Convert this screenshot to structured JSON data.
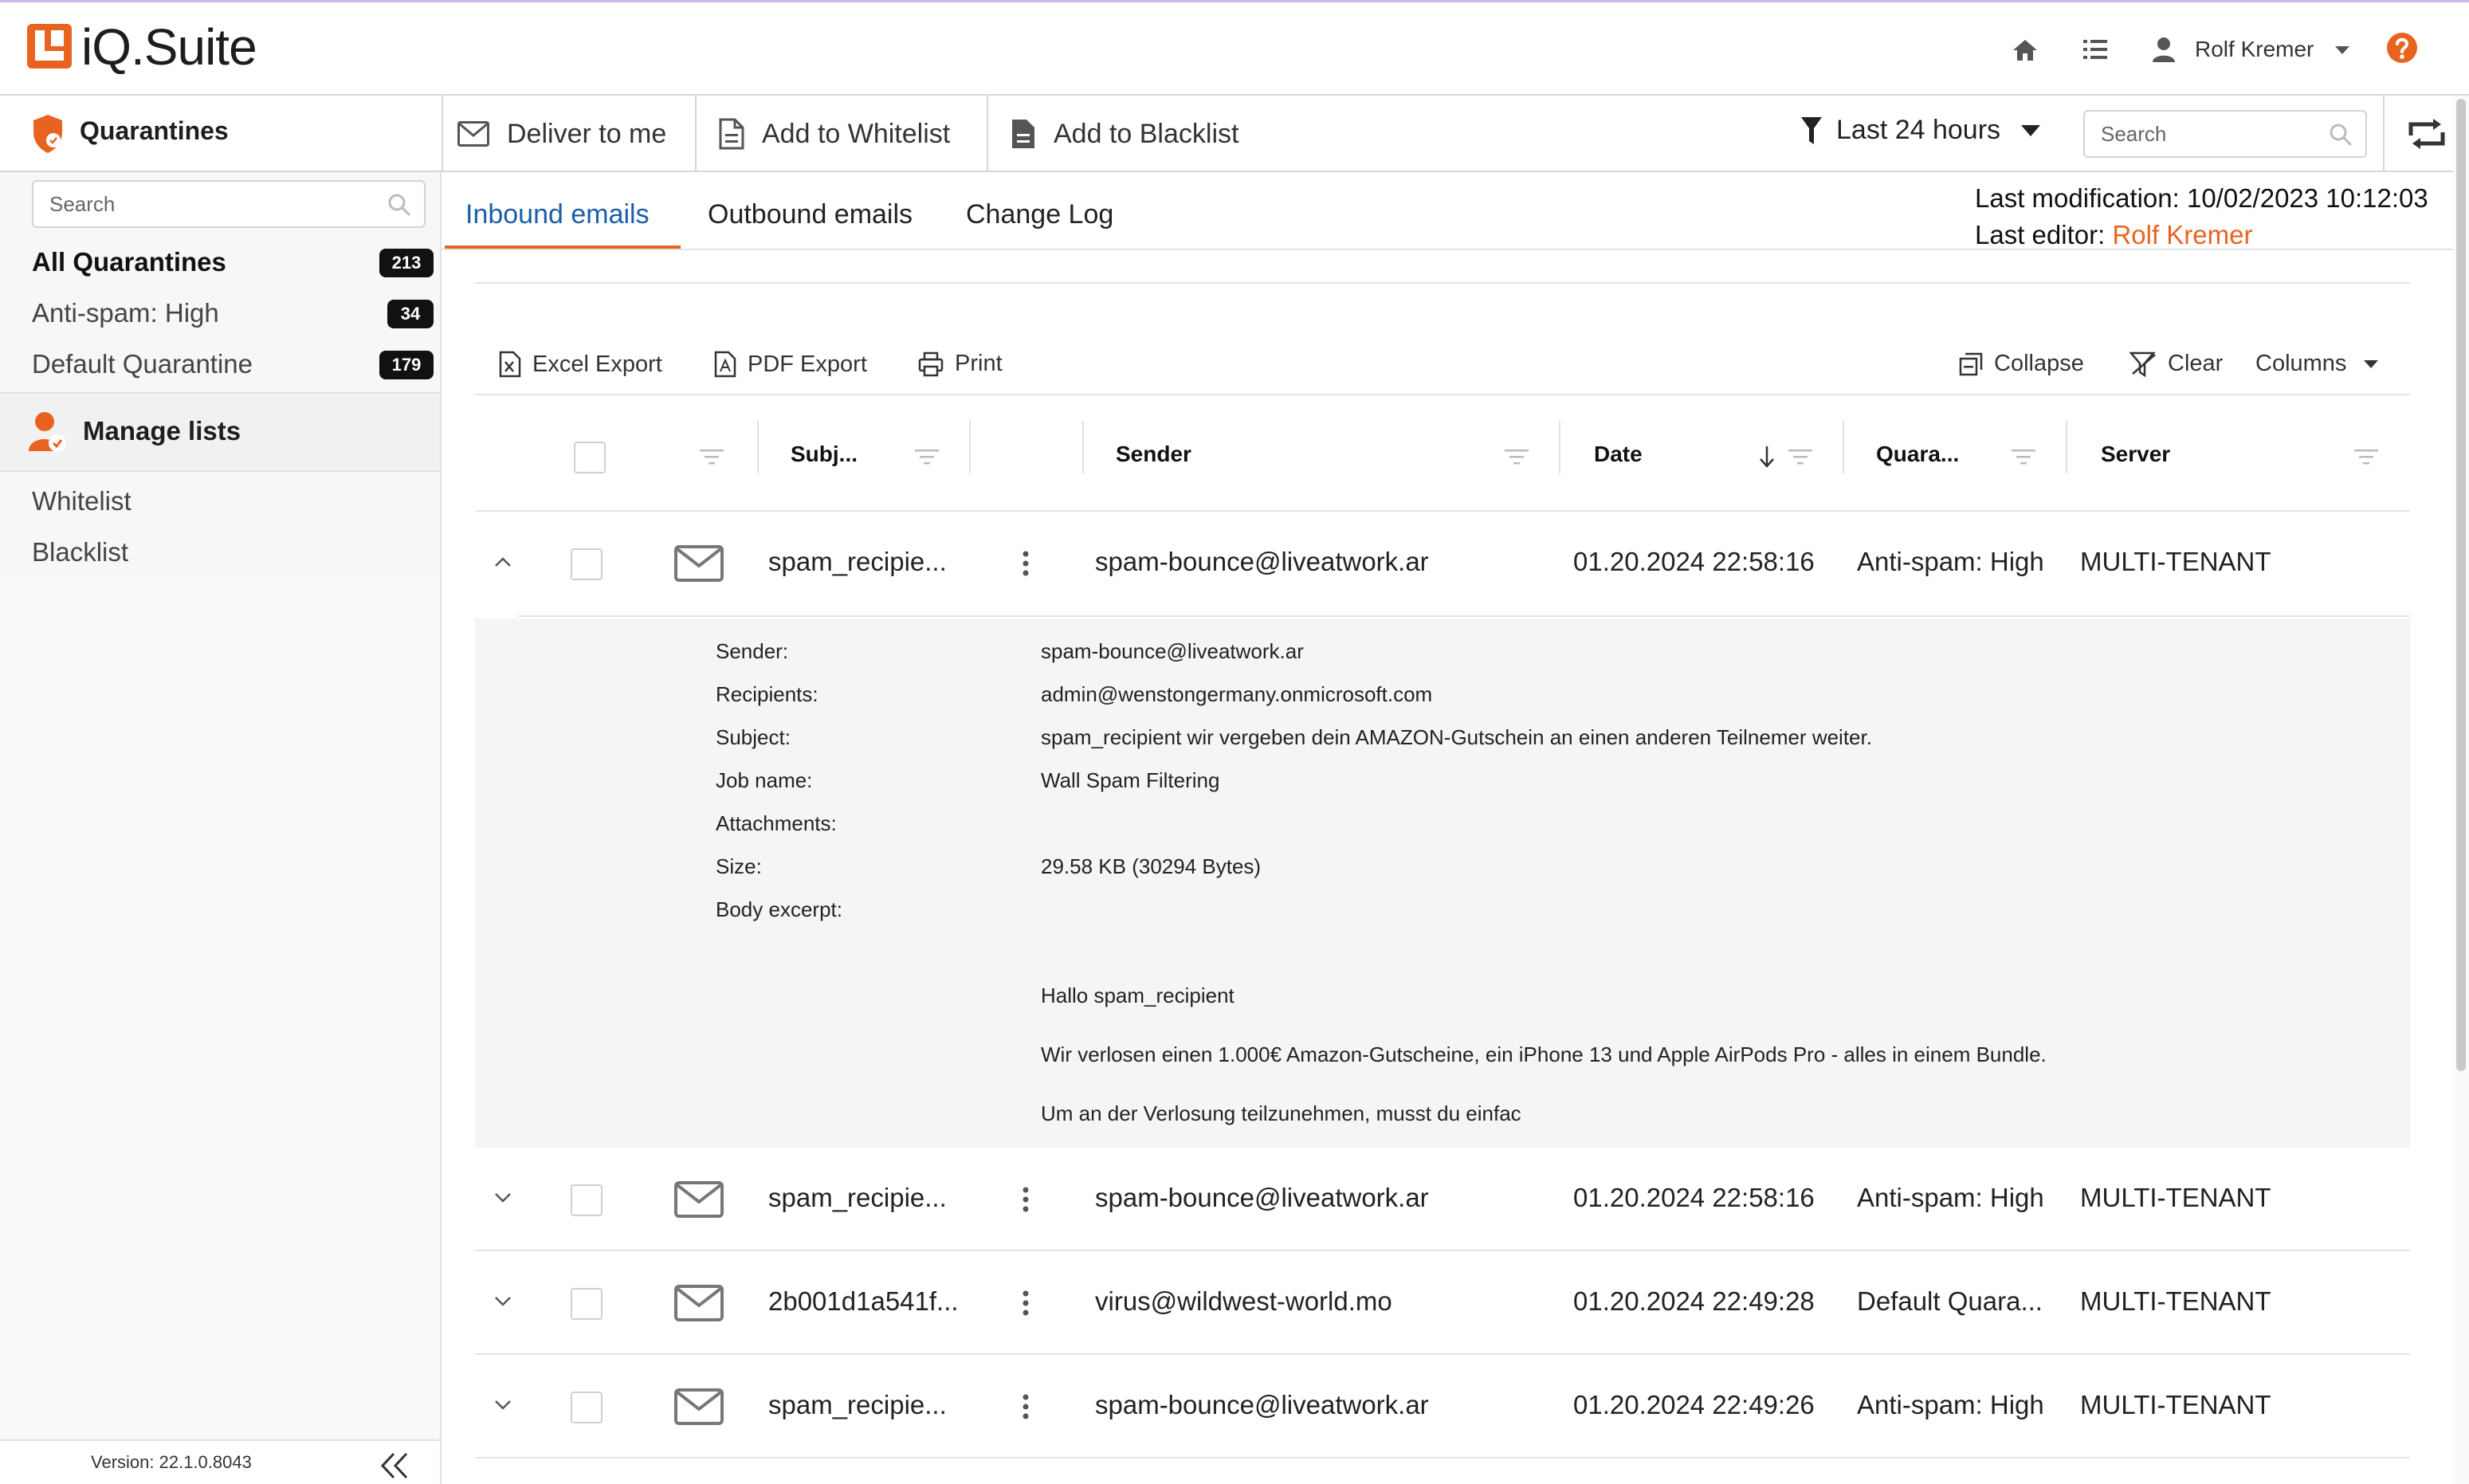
{
  "app": {
    "title": "iQ.Suite"
  },
  "user": {
    "name": "Rolf Kremer"
  },
  "icons": {
    "logo": "iq-suite-logo",
    "home": "home-icon",
    "list": "list-icon",
    "user": "user-icon",
    "help": "help-icon",
    "search": "search-icon",
    "refresh": "refresh-icon",
    "mail": "envelope-icon"
  },
  "colors": {
    "accent": "#e8631f",
    "link": "#1b5ea7",
    "badge": "#111111"
  },
  "toolbar": {
    "section_title": "Quarantines",
    "deliver_label": "Deliver to me",
    "whitelist_label": "Add to Whitelist",
    "blacklist_label": "Add to Blacklist",
    "filter_label": "Last 24 hours",
    "search_placeholder": "Search"
  },
  "sidebar": {
    "search_placeholder": "Search",
    "quarantines": [
      {
        "label": "All Quarantines",
        "count": "213"
      },
      {
        "label": "Anti-spam: High",
        "count": "34"
      },
      {
        "label": "Default Quarantine",
        "count": "179"
      }
    ],
    "manage_lists_title": "Manage lists",
    "lists": [
      {
        "label": "Whitelist"
      },
      {
        "label": "Blacklist"
      }
    ],
    "version": "Version: 22.1.0.8043"
  },
  "tabs": [
    {
      "label": "Inbound emails"
    },
    {
      "label": "Outbound emails"
    },
    {
      "label": "Change Log"
    }
  ],
  "meta": {
    "last_modification": "Last modification: 10/02/2023 10:12:03",
    "last_editor_label": "Last editor:",
    "last_editor_name": "Rolf Kremer"
  },
  "actions": {
    "excel": "Excel Export",
    "pdf": "PDF Export",
    "print": "Print",
    "collapse": "Collapse",
    "clear": "Clear",
    "columns": "Columns"
  },
  "table": {
    "columns": [
      "Subj...",
      "Sender",
      "Date",
      "Quara...",
      "Server"
    ],
    "rows": [
      {
        "subject": "spam_recipie...",
        "sender": "spam-bounce@liveatwork.ar",
        "date": "01.20.2024 22:58:16",
        "quarantine": "Anti-spam: High",
        "server": "MULTI-TENANT",
        "expanded": true
      },
      {
        "subject": "spam_recipie...",
        "sender": "spam-bounce@liveatwork.ar",
        "date": "01.20.2024 22:58:16",
        "quarantine": "Anti-spam: High",
        "server": "MULTI-TENANT",
        "expanded": false
      },
      {
        "subject": "2b001d1a541f...",
        "sender": "virus@wildwest-world.mo",
        "date": "01.20.2024 22:49:28",
        "quarantine": "Default Quara...",
        "server": "MULTI-TENANT",
        "expanded": false
      },
      {
        "subject": "spam_recipie...",
        "sender": "spam-bounce@liveatwork.ar",
        "date": "01.20.2024 22:49:26",
        "quarantine": "Anti-spam: High",
        "server": "MULTI-TENANT",
        "expanded": false
      }
    ]
  },
  "detail": {
    "labels": {
      "sender": "Sender:",
      "recipients": "Recipients:",
      "subject": "Subject:",
      "job": "Job name:",
      "attachments": "Attachments:",
      "size": "Size:",
      "body": "Body excerpt:"
    },
    "values": {
      "sender": "spam-bounce@liveatwork.ar",
      "recipients": "admin@wenstongermany.onmicrosoft.com",
      "subject": "spam_recipient wir vergeben dein AMAZON-Gutschein an einen anderen Teilnemer weiter.",
      "job": "Wall Spam Filtering",
      "attachments": "",
      "size": "29.58 KB (30294 Bytes)",
      "body_line1": "Hallo spam_recipient",
      "body_line2": "Wir verlosen einen 1.000€ Amazon-Gutscheine, ein iPhone 13 und Apple AirPods Pro - alles in einem Bundle.",
      "body_line3": "Um an der Verlosung teilzunehmen, musst du einfac"
    }
  }
}
